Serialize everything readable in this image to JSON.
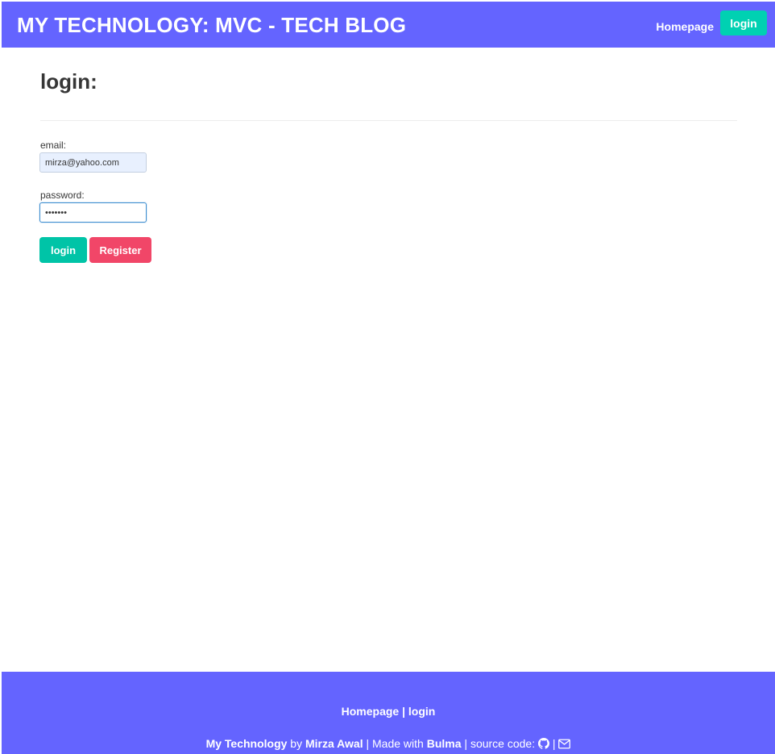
{
  "header": {
    "brand": "MY TECHNOLOGY: MVC - TECH BLOG",
    "nav_home": "Homepage",
    "nav_login": "login"
  },
  "main": {
    "title": "login:",
    "email_label": "email:",
    "email_value": "mirza@yahoo.com",
    "password_label": "password:",
    "password_value": "•••••••",
    "login_button": "login",
    "register_button": "Register"
  },
  "footer": {
    "link_home": "Homepage",
    "link_sep": " | ",
    "link_login": "login",
    "credit_name": "My Technology",
    "credit_by": " by ",
    "credit_author": "Mirza Awal",
    "credit_made": " | Made with ",
    "credit_framework": "Bulma",
    "credit_sep1": " | ",
    "credit_source": "source code: ",
    "credit_sep2": " | "
  },
  "colors": {
    "navbar": "#6464ff",
    "primary": "#00d1b2",
    "danger": "#f14668"
  },
  "icons": [
    "github-icon",
    "envelope-icon"
  ]
}
